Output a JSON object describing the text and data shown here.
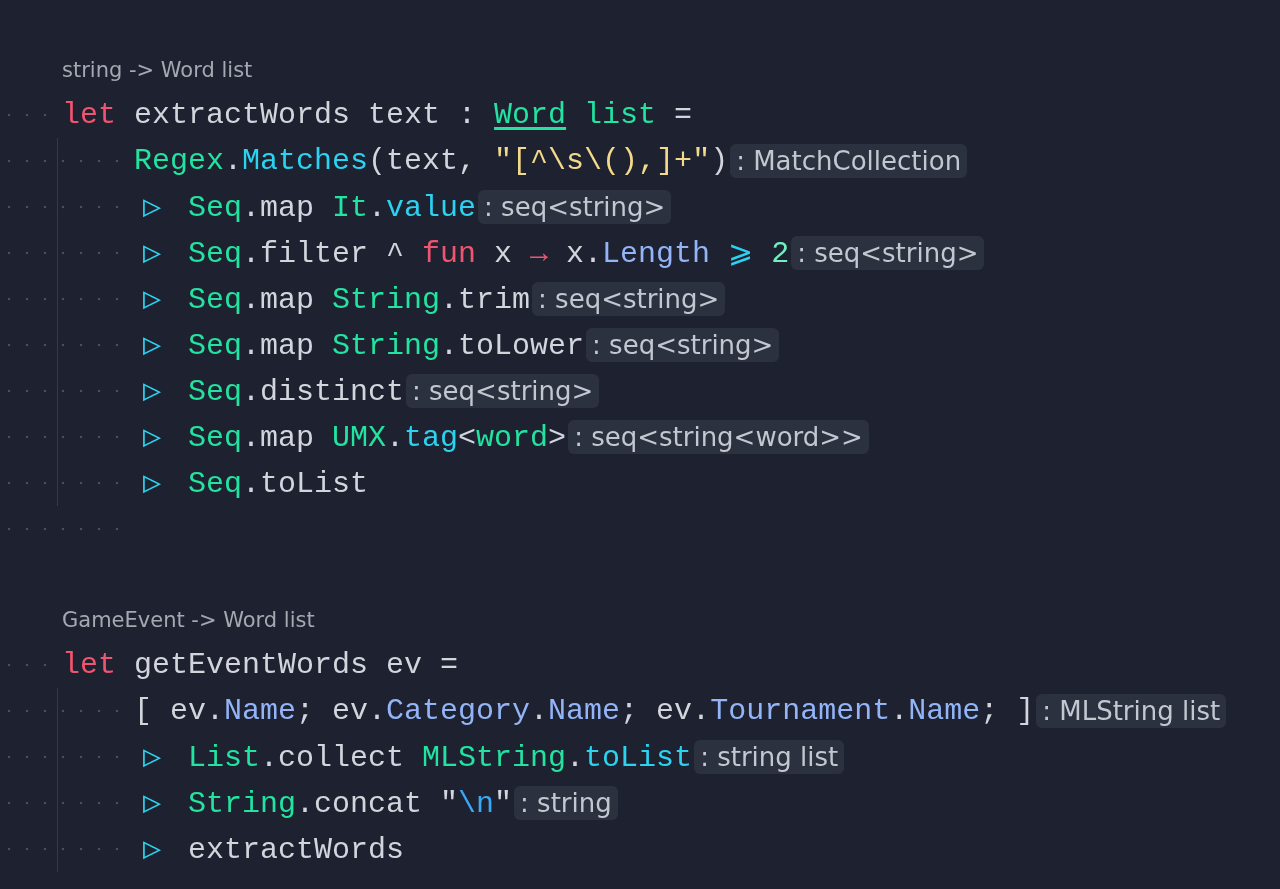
{
  "blocks": [
    {
      "signature": "string -> Word list",
      "lines": [
        {
          "kind": "decl",
          "tokens": [
            {
              "kind": "keyword",
              "text": "let"
            },
            {
              "kind": "plain",
              "text": " extractWords text : "
            },
            {
              "kind": "type_link",
              "text": "Word"
            },
            {
              "kind": "type",
              "text": " list"
            },
            {
              "kind": "plain",
              "text": " ="
            }
          ]
        },
        {
          "kind": "body",
          "tokens": [
            {
              "kind": "module",
              "text": "Regex"
            },
            {
              "kind": "plain",
              "text": "."
            },
            {
              "kind": "method",
              "text": "Matches"
            },
            {
              "kind": "plain",
              "text": "(text, "
            },
            {
              "kind": "string",
              "text": "\"[^\\s\\(),]+\""
            },
            {
              "kind": "plain",
              "text": ")"
            }
          ],
          "hint": ": MatchCollection"
        },
        {
          "kind": "body",
          "tokens": [
            {
              "kind": "pipe",
              "text": "▷"
            },
            {
              "kind": "module",
              "text": " Seq"
            },
            {
              "kind": "plain",
              "text": ".map "
            },
            {
              "kind": "module",
              "text": "It"
            },
            {
              "kind": "plain",
              "text": "."
            },
            {
              "kind": "method",
              "text": "value"
            }
          ],
          "hint": ": seq<string>"
        },
        {
          "kind": "body",
          "tokens": [
            {
              "kind": "pipe",
              "text": "▷"
            },
            {
              "kind": "module",
              "text": " Seq"
            },
            {
              "kind": "plain",
              "text": ".filter ^ "
            },
            {
              "kind": "keyword",
              "text": "fun"
            },
            {
              "kind": "plain",
              "text": " x "
            },
            {
              "kind": "keyword",
              "text": "→"
            },
            {
              "kind": "plain",
              "text": " x."
            },
            {
              "kind": "property",
              "text": "Length"
            },
            {
              "kind": "operator",
              "text": " ⩾"
            },
            {
              "kind": "number",
              "text": " 2"
            }
          ],
          "hint": ": seq<string>"
        },
        {
          "kind": "body",
          "tokens": [
            {
              "kind": "pipe",
              "text": "▷"
            },
            {
              "kind": "module",
              "text": " Seq"
            },
            {
              "kind": "plain",
              "text": ".map "
            },
            {
              "kind": "module",
              "text": "String"
            },
            {
              "kind": "plain",
              "text": ".trim"
            }
          ],
          "hint": ": seq<string>"
        },
        {
          "kind": "body",
          "tokens": [
            {
              "kind": "pipe",
              "text": "▷"
            },
            {
              "kind": "module",
              "text": " Seq"
            },
            {
              "kind": "plain",
              "text": ".map "
            },
            {
              "kind": "module",
              "text": "String"
            },
            {
              "kind": "plain",
              "text": ".toLower"
            }
          ],
          "hint": ": seq<string>"
        },
        {
          "kind": "body",
          "tokens": [
            {
              "kind": "pipe",
              "text": "▷"
            },
            {
              "kind": "module",
              "text": " Seq"
            },
            {
              "kind": "plain",
              "text": ".distinct"
            }
          ],
          "hint": ": seq<string>"
        },
        {
          "kind": "body",
          "tokens": [
            {
              "kind": "pipe",
              "text": "▷"
            },
            {
              "kind": "module",
              "text": " Seq"
            },
            {
              "kind": "plain",
              "text": ".map "
            },
            {
              "kind": "module",
              "text": "UMX"
            },
            {
              "kind": "plain",
              "text": "."
            },
            {
              "kind": "method",
              "text": "tag"
            },
            {
              "kind": "plain",
              "text": "<"
            },
            {
              "kind": "module",
              "text": "word"
            },
            {
              "kind": "plain",
              "text": ">"
            }
          ],
          "hint": ": seq<string<word>>"
        },
        {
          "kind": "body",
          "tokens": [
            {
              "kind": "pipe",
              "text": "▷"
            },
            {
              "kind": "module",
              "text": " Seq"
            },
            {
              "kind": "plain",
              "text": ".toList"
            }
          ]
        }
      ]
    },
    {
      "signature": "GameEvent -> Word list",
      "lines": [
        {
          "kind": "decl",
          "tokens": [
            {
              "kind": "keyword",
              "text": "let"
            },
            {
              "kind": "plain",
              "text": " getEventWords ev ="
            }
          ]
        },
        {
          "kind": "body",
          "tokens": [
            {
              "kind": "plain",
              "text": "[ ev."
            },
            {
              "kind": "property",
              "text": "Name"
            },
            {
              "kind": "plain",
              "text": "; ev."
            },
            {
              "kind": "property",
              "text": "Category"
            },
            {
              "kind": "plain",
              "text": "."
            },
            {
              "kind": "property",
              "text": "Name"
            },
            {
              "kind": "plain",
              "text": "; ev."
            },
            {
              "kind": "property",
              "text": "Tournament"
            },
            {
              "kind": "plain",
              "text": "."
            },
            {
              "kind": "property",
              "text": "Name"
            },
            {
              "kind": "plain",
              "text": "; ]"
            }
          ],
          "hint": ": MLString list"
        },
        {
          "kind": "body",
          "tokens": [
            {
              "kind": "pipe",
              "text": "▷"
            },
            {
              "kind": "module",
              "text": " List"
            },
            {
              "kind": "plain",
              "text": ".collect "
            },
            {
              "kind": "module",
              "text": "MLString"
            },
            {
              "kind": "plain",
              "text": "."
            },
            {
              "kind": "method",
              "text": "toList"
            }
          ],
          "hint": ": string list"
        },
        {
          "kind": "body",
          "tokens": [
            {
              "kind": "pipe",
              "text": "▷"
            },
            {
              "kind": "module",
              "text": " String"
            },
            {
              "kind": "plain",
              "text": ".concat \""
            },
            {
              "kind": "escape",
              "text": "\\n"
            },
            {
              "kind": "plain",
              "text": "\""
            }
          ],
          "hint": ": string"
        },
        {
          "kind": "body",
          "tokens": [
            {
              "kind": "pipe",
              "text": "▷"
            },
            {
              "kind": "plain",
              "text": " extractWords"
            }
          ]
        }
      ]
    }
  ]
}
